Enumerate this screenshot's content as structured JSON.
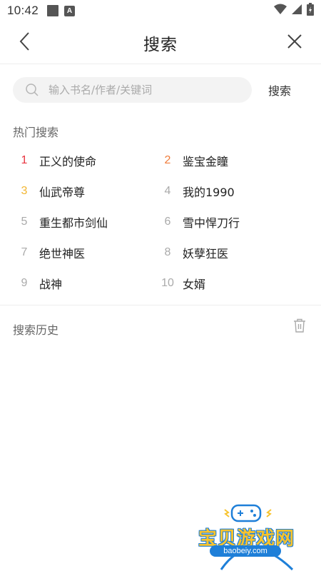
{
  "status_bar": {
    "time": "10:42",
    "icons": [
      "notification-square-icon",
      "a-app-icon",
      "wifi-icon",
      "signal-icon",
      "battery-charging-icon"
    ]
  },
  "nav": {
    "title": "搜索",
    "back_icon": "chevron-left-icon",
    "close_icon": "close-icon"
  },
  "search": {
    "placeholder": "输入书名/作者/关键词",
    "value": "",
    "button_label": "搜索",
    "icon": "search-icon"
  },
  "hot_search": {
    "title": "热门搜索",
    "items": [
      {
        "rank": "1",
        "name": "正义的使命",
        "rank_color": "#e8333f"
      },
      {
        "rank": "2",
        "name": "鉴宝金瞳",
        "rank_color": "#f07c3a"
      },
      {
        "rank": "3",
        "name": "仙武帝尊",
        "rank_color": "#f2b632"
      },
      {
        "rank": "4",
        "name": "我的1990",
        "rank_color": "#aaaaaa"
      },
      {
        "rank": "5",
        "name": "重生都市剑仙",
        "rank_color": "#aaaaaa"
      },
      {
        "rank": "6",
        "name": "雪中悍刀行",
        "rank_color": "#aaaaaa"
      },
      {
        "rank": "7",
        "name": "绝世神医",
        "rank_color": "#aaaaaa"
      },
      {
        "rank": "8",
        "name": "妖孽狂医",
        "rank_color": "#aaaaaa"
      },
      {
        "rank": "9",
        "name": "战神",
        "rank_color": "#aaaaaa"
      },
      {
        "rank": "10",
        "name": "女婿",
        "rank_color": "#aaaaaa"
      }
    ]
  },
  "history": {
    "title": "搜索历史",
    "clear_icon": "trash-icon"
  },
  "watermark": {
    "text": "宝贝游戏网",
    "url": "baobeiy.com"
  },
  "colors": {
    "rank_first": "#e8333f",
    "rank_second": "#f07c3a",
    "rank_third": "#f2b632",
    "rank_other": "#aaaaaa",
    "search_bg": "#f3f3f3"
  }
}
